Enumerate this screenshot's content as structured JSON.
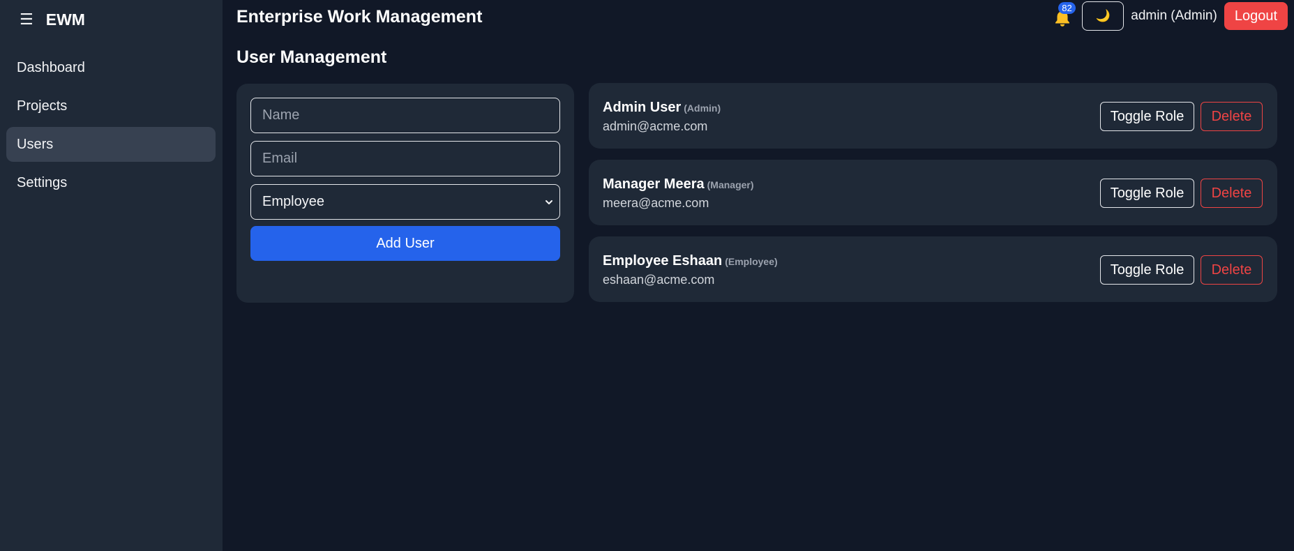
{
  "sidebar": {
    "menu_icon": "☰",
    "brand": "EWM",
    "items": [
      {
        "label": "Dashboard"
      },
      {
        "label": "Projects"
      },
      {
        "label": "Users"
      },
      {
        "label": "Settings"
      }
    ],
    "active_item": "Users"
  },
  "header": {
    "title": "Enterprise Work Management",
    "notification_count": "82",
    "theme_icon": "🌙",
    "user_label": "admin (Admin)",
    "logout_label": "Logout"
  },
  "page": {
    "title": "User Management"
  },
  "form": {
    "name_placeholder": "Name",
    "email_placeholder": "Email",
    "role_selected": "Employee",
    "add_label": "Add User"
  },
  "users": [
    {
      "name": "Admin User",
      "role": "(Admin)",
      "email": "admin@acme.com"
    },
    {
      "name": "Manager Meera",
      "role": "(Manager)",
      "email": "meera@acme.com"
    },
    {
      "name": "Employee Eshaan",
      "role": "(Employee)",
      "email": "eshaan@acme.com"
    }
  ],
  "actions": {
    "toggle_label": "Toggle Role",
    "delete_label": "Delete"
  },
  "colors": {
    "background": "#111827",
    "sidebar": "#1f2937",
    "card": "#1f2937",
    "accent": "#2563eb",
    "danger": "#ef4444",
    "bell": "#fbbf24"
  }
}
